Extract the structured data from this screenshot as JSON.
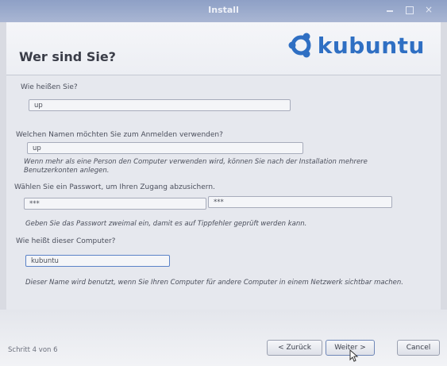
{
  "window": {
    "title": "Install"
  },
  "header": {
    "title": "Wer sind Sie?",
    "logo_text": "kubuntu"
  },
  "form": {
    "name_label": "Wie heißen Sie?",
    "name_value": "up",
    "login_label": "Welchen Namen möchten Sie zum Anmelden verwenden?",
    "login_value": "up",
    "login_hint_1": "Wenn mehr als eine Person den Computer verwenden wird, können Sie nach der Installation mehrere",
    "login_hint_2": "Benutzerkonten anlegen.",
    "password_label": "Wählen Sie ein Passwort, um Ihren Zugang abzusichern.",
    "password_value": "***",
    "password_confirm_value": "***",
    "password_hint": "Geben Sie das Passwort zweimal ein, damit es auf Tippfehler geprüft werden kann.",
    "computer_label": "Wie heißt dieser Computer?",
    "computer_value": "kubuntu",
    "computer_hint": "Dieser Name wird benutzt, wenn Sie Ihren Computer für andere Computer in einem Netzwerk sichtbar machen."
  },
  "footer": {
    "step": "Schritt 4 von 6",
    "back_label": "< Zurück",
    "next_label": "Weiter >",
    "cancel_label": "Cancel"
  },
  "colors": {
    "accent": "#2f6fc3",
    "titlebar": "#9aaad0"
  }
}
